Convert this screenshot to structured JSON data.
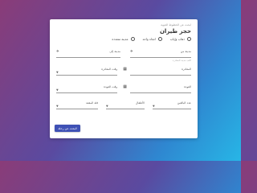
{
  "form": {
    "subtitle": "ابحث عن الخطوط الجوية",
    "title": "حجز طيران",
    "trip_types": [
      {
        "label": "ذهاب وإياب",
        "selected": false
      },
      {
        "label": "اتجاه واحد",
        "selected": false
      },
      {
        "label": "مدينة متعددة",
        "selected": false
      }
    ],
    "from_label": "مدينة من",
    "from_helper": "اكتب مدينة المغادرة",
    "to_label": "مدينة إلى",
    "departure_label": "المغادرة",
    "departure_time_label": "وقت المغادرة",
    "return_label": "العودة",
    "return_time_label": "وقت العودة",
    "adults_label": "عدد البالغين",
    "children_label": "الأطفال",
    "class_label": "فئة المقعد",
    "search_button": "البحث عن رحلة"
  }
}
